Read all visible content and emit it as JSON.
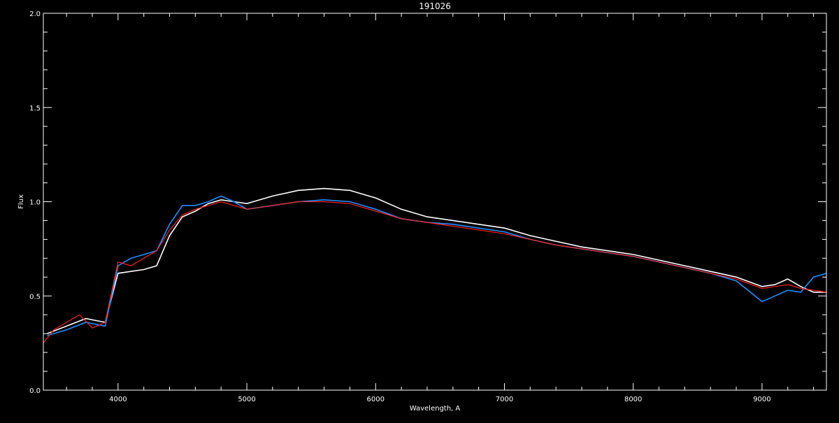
{
  "chart_data": {
    "type": "line",
    "title": "191026",
    "xlabel": "Wavelength, A",
    "ylabel": "Flux",
    "xlim": [
      3420,
      9500
    ],
    "ylim": [
      0.0,
      2.0
    ],
    "x_ticks": [
      4000,
      5000,
      6000,
      7000,
      8000,
      9000
    ],
    "x_tick_labels": [
      "4000",
      "5000",
      "6000",
      "7000",
      "8000",
      "9000"
    ],
    "y_ticks": [
      0.0,
      0.5,
      1.0,
      1.5,
      2.0
    ],
    "y_tick_labels": [
      "0.0",
      "0.5",
      "1.0",
      "1.5",
      "2.0"
    ],
    "grid": false,
    "background": "#000000",
    "axis_color": "#ffffff",
    "series": [
      {
        "color": "#ffffff",
        "x": [
          3450,
          3600,
          3750,
          3900,
          4000,
          4100,
          4200,
          4300,
          4400,
          4500,
          4600,
          4700,
          4800,
          4900,
          5000,
          5200,
          5400,
          5600,
          5800,
          6000,
          6200,
          6400,
          6600,
          6800,
          7000,
          7200,
          7400,
          7600,
          7800,
          8000,
          8200,
          8400,
          8600,
          8800,
          9000,
          9100,
          9200,
          9300,
          9400,
          9500
        ],
        "y": [
          0.3,
          0.34,
          0.38,
          0.36,
          0.62,
          0.63,
          0.64,
          0.66,
          0.82,
          0.92,
          0.95,
          0.99,
          1.01,
          1.0,
          0.99,
          1.03,
          1.06,
          1.07,
          1.06,
          1.02,
          0.96,
          0.92,
          0.9,
          0.88,
          0.86,
          0.82,
          0.79,
          0.76,
          0.74,
          0.72,
          0.69,
          0.66,
          0.63,
          0.6,
          0.55,
          0.56,
          0.59,
          0.55,
          0.52,
          0.52
        ]
      },
      {
        "color": "#1e90ff",
        "x": [
          3450,
          3600,
          3750,
          3900,
          4000,
          4100,
          4200,
          4300,
          4400,
          4500,
          4600,
          4700,
          4800,
          4900,
          5000,
          5200,
          5400,
          5600,
          5800,
          6000,
          6200,
          6400,
          6600,
          6800,
          7000,
          7200,
          7400,
          7600,
          7800,
          8000,
          8200,
          8400,
          8600,
          8800,
          9000,
          9100,
          9200,
          9300,
          9400,
          9500
        ],
        "y": [
          0.29,
          0.32,
          0.36,
          0.34,
          0.66,
          0.7,
          0.72,
          0.74,
          0.88,
          0.98,
          0.98,
          1.0,
          1.03,
          1.0,
          0.96,
          0.98,
          1.0,
          1.01,
          1.0,
          0.96,
          0.91,
          0.89,
          0.88,
          0.86,
          0.84,
          0.8,
          0.77,
          0.75,
          0.73,
          0.71,
          0.68,
          0.65,
          0.62,
          0.58,
          0.47,
          0.5,
          0.53,
          0.52,
          0.6,
          0.62
        ]
      },
      {
        "color": "#ff2020",
        "x": [
          3420,
          3500,
          3600,
          3700,
          3800,
          3900,
          4000,
          4100,
          4200,
          4300,
          4400,
          4500,
          4600,
          4700,
          4800,
          4900,
          5000,
          5200,
          5400,
          5600,
          5800,
          6000,
          6200,
          6400,
          6600,
          6800,
          7000,
          7200,
          7400,
          7600,
          7800,
          8000,
          8200,
          8400,
          8600,
          8800,
          9000,
          9100,
          9200,
          9300,
          9400,
          9500
        ],
        "y": [
          0.25,
          0.32,
          0.36,
          0.4,
          0.33,
          0.36,
          0.68,
          0.66,
          0.7,
          0.74,
          0.85,
          0.93,
          0.96,
          0.98,
          1.0,
          0.98,
          0.96,
          0.98,
          1.0,
          1.0,
          0.99,
          0.95,
          0.91,
          0.89,
          0.87,
          0.85,
          0.83,
          0.8,
          0.77,
          0.75,
          0.73,
          0.71,
          0.68,
          0.65,
          0.62,
          0.59,
          0.54,
          0.55,
          0.56,
          0.54,
          0.53,
          0.52
        ]
      }
    ]
  }
}
